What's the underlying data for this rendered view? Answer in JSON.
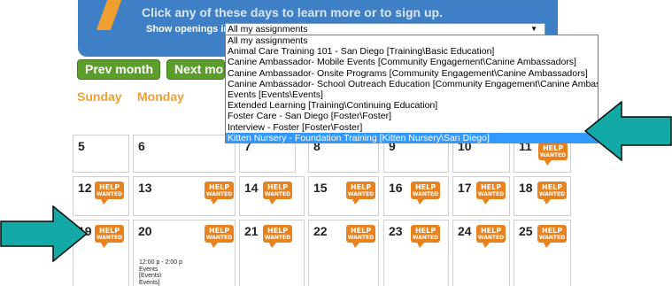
{
  "banner": {
    "instruction": "Click any of these days to learn more or to sign up.",
    "show_label": "Show openings in",
    "selected_value": "All my assignments"
  },
  "dropdown_options": [
    "All my assignments",
    "Animal Care Training 101 - San Diego [Training\\Basic Education]",
    "Canine Ambassador- Mobile Events [Community Engagement\\Canine Ambassadors]",
    "Canine Ambassador- Onsite Programs [Community Engagement\\Canine Ambassadors]",
    "Canine Ambassador- School Outreach Education [Community Engagement\\Canine Ambassadors]",
    "Events [Events\\Events]",
    "Extended Learning [Training\\Continuing Education]",
    "Foster Care - San Diego [Foster\\Foster]",
    "Interview - Foster [Foster\\Foster]",
    "Kitten Nursery - Foundation Training [Kitten Nursery\\San Diego]"
  ],
  "nav": {
    "prev_label": "Prev month",
    "next_label": "Next mo"
  },
  "day_names": {
    "sunday": "Sunday",
    "monday": "Monday"
  },
  "help_badge": {
    "line1": "HELP",
    "line2": "WANTED"
  },
  "days": {
    "d5": "5",
    "d6": "6",
    "d7": "7",
    "d8": "8",
    "d9": "9",
    "d10": "10",
    "d11": "11",
    "d12": "12",
    "d13": "13",
    "d14": "14",
    "d15": "15",
    "d16": "16",
    "d17": "17",
    "d18": "18",
    "d19": "19",
    "d20": "20",
    "d21": "21",
    "d22": "22",
    "d23": "23",
    "d24": "24",
    "d25": "25"
  },
  "event_20": {
    "time": "12:00 p - 2:00 p",
    "line1": "Events",
    "line2": "[Events\\",
    "line3": "Events]"
  },
  "colors": {
    "banner": "#3f7fc6",
    "nav_button": "#5c9e2b",
    "day_name": "#f0a030",
    "badge": "#e8821e",
    "highlight": "#3399ff",
    "arrow": "#13a9a6"
  }
}
